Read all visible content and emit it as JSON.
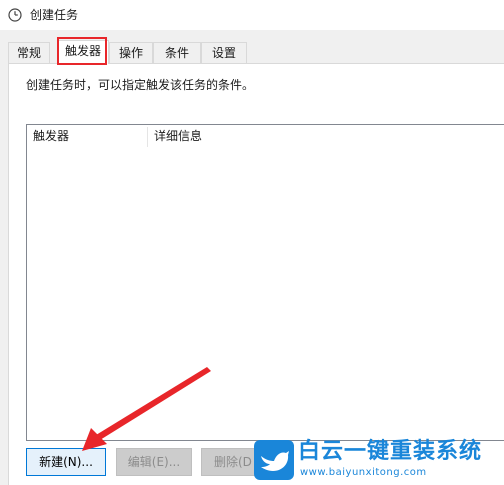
{
  "window": {
    "title": "创建任务",
    "icon": "clock-icon"
  },
  "tabs": [
    {
      "label": "常规",
      "active": false
    },
    {
      "label": "触发器",
      "active": true
    },
    {
      "label": "操作",
      "active": false
    },
    {
      "label": "条件",
      "active": false
    },
    {
      "label": "设置",
      "active": false
    }
  ],
  "panel": {
    "description": "创建任务时，可以指定触发该任务的条件。"
  },
  "triggers_list": {
    "columns": [
      "触发器",
      "详细信息"
    ],
    "rows": []
  },
  "buttons": {
    "new_label": "新建(N)...",
    "edit_label": "编辑(E)...",
    "delete_label": "删除(D"
  },
  "watermark": {
    "name": "白云一键重装系统",
    "url": "www.baiyunxitong.com"
  },
  "colors": {
    "highlight": "#e8262a",
    "arrow": "#e8262a",
    "watermark": "#1a86d9",
    "focus_border": "#0078d7"
  }
}
